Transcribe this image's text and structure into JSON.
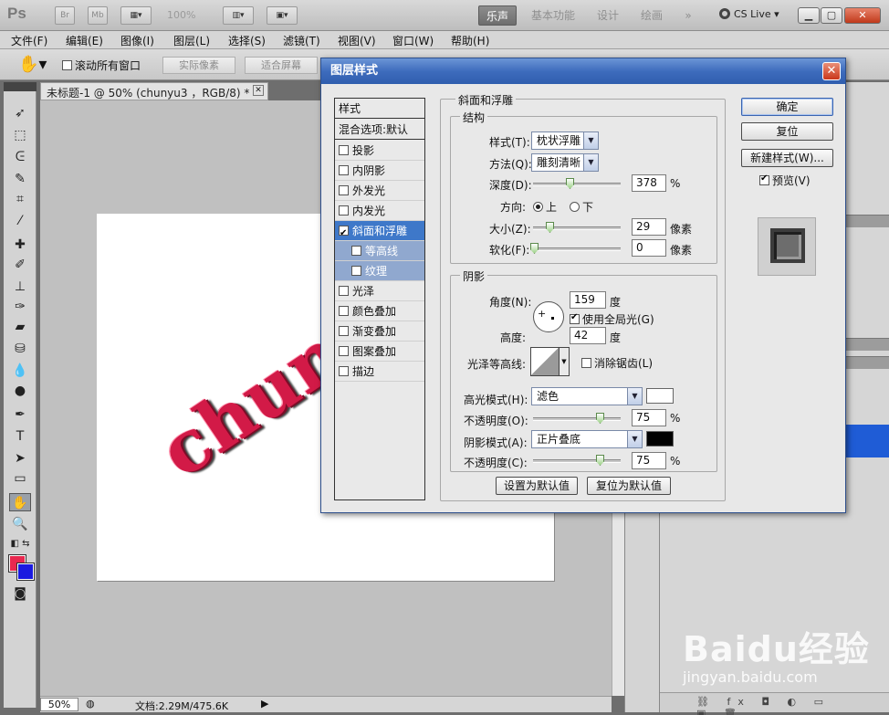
{
  "app": {
    "logo": "Ps",
    "mini_buttons": [
      "Br",
      "Mb"
    ],
    "zoom_display": "100%",
    "workspaces": [
      "乐声",
      "基本功能",
      "设计",
      "绘画"
    ],
    "overflow": "»",
    "cs_live": "CS Live"
  },
  "menu": [
    "文件(F)",
    "编辑(E)",
    "图像(I)",
    "图层(L)",
    "选择(S)",
    "滤镜(T)",
    "视图(V)",
    "窗口(W)",
    "帮助(H)"
  ],
  "options_bar": {
    "scroll_all_label": "滚动所有窗口",
    "actual_pixels": "实际像素",
    "fit_screen": "适合屏幕"
  },
  "document": {
    "tab_title": "未标题-1 @ 50% (chunyu3 ，RGB/8) *",
    "canvas_text": "chunyu",
    "zoom": "50%",
    "doc_size": "文档:2.29M/475.6K"
  },
  "colors": {
    "foreground": "#e8284f",
    "background": "#1a1ae0",
    "dialog_title": "#3e6cbd"
  },
  "dialog": {
    "title": "图层样式",
    "style_list": {
      "header": "样式",
      "blend": "混合选项:默认",
      "items": [
        {
          "label": "投影",
          "checked": false
        },
        {
          "label": "内阴影",
          "checked": false
        },
        {
          "label": "外发光",
          "checked": false
        },
        {
          "label": "内发光",
          "checked": false
        },
        {
          "label": "斜面和浮雕",
          "checked": true,
          "selected": true
        },
        {
          "label": "等高线",
          "checked": false,
          "sub": true
        },
        {
          "label": "纹理",
          "checked": false,
          "sub": true
        },
        {
          "label": "光泽",
          "checked": false
        },
        {
          "label": "颜色叠加",
          "checked": false
        },
        {
          "label": "渐变叠加",
          "checked": false
        },
        {
          "label": "图案叠加",
          "checked": false
        },
        {
          "label": "描边",
          "checked": false
        }
      ]
    },
    "bevel": {
      "section_title": "斜面和浮雕",
      "structure_title": "结构",
      "style_label": "样式(T):",
      "style_value": "枕状浮雕",
      "technique_label": "方法(Q):",
      "technique_value": "雕刻清晰",
      "depth_label": "深度(D):",
      "depth_value": "378",
      "depth_unit": "%",
      "direction_label": "方向:",
      "dir_up": "上",
      "dir_down": "下",
      "size_label": "大小(Z):",
      "size_value": "29",
      "size_unit": "像素",
      "soften_label": "软化(F):",
      "soften_value": "0",
      "soften_unit": "像素"
    },
    "shading": {
      "title": "阴影",
      "angle_label": "角度(N):",
      "angle_value": "159",
      "angle_unit": "度",
      "global_light_label": "使用全局光(G)",
      "altitude_label": "高度:",
      "altitude_value": "42",
      "altitude_unit": "度",
      "gloss_label": "光泽等高线:",
      "anti_alias_label": "消除锯齿(L)",
      "highlight_mode_label": "高光模式(H):",
      "highlight_mode_value": "滤色",
      "highlight_color": "#ffffff",
      "highlight_opacity_label": "不透明度(O):",
      "highlight_opacity_value": "75",
      "shadow_mode_label": "阴影模式(A):",
      "shadow_mode_value": "正片叠底",
      "shadow_color": "#000000",
      "shadow_opacity_label": "不透明度(C):",
      "shadow_opacity_value": "75",
      "percent": "%"
    },
    "make_default": "设置为默认值",
    "reset_default": "复位为默认值",
    "ok": "确定",
    "reset": "复位",
    "new_style": "新建样式(W)...",
    "preview_label": "预览(V)"
  },
  "watermark": {
    "logo": "Baidu经验",
    "url": "jingyan.baidu.com"
  }
}
